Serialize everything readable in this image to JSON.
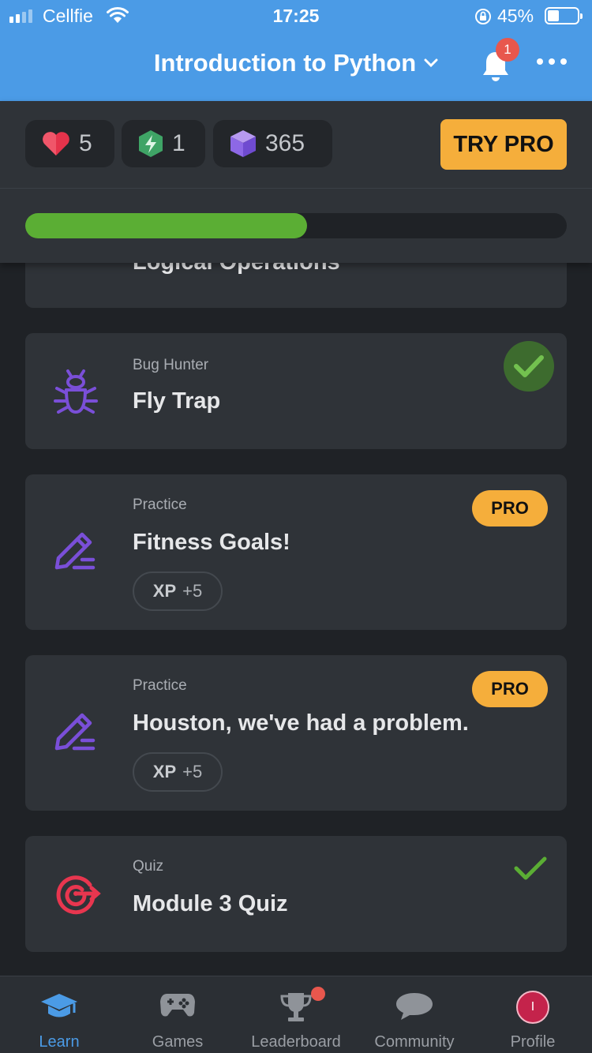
{
  "status_bar": {
    "carrier": "Cellfie",
    "time": "17:25",
    "battery_percent": "45%",
    "battery_level": 0.45
  },
  "header": {
    "title": "Introduction to Python",
    "notification_count": "1"
  },
  "stats": {
    "hearts": "5",
    "energy": "1",
    "gems": "365",
    "try_pro_label": "TRY PRO",
    "course_progress": 0.52
  },
  "cards": [
    {
      "type": "",
      "name": "Logical Operations",
      "icon": "partial"
    },
    {
      "type": "Bug Hunter",
      "name": "Fly Trap",
      "icon": "bug-icon",
      "status": "completed"
    },
    {
      "type": "Practice",
      "name": "Fitness Goals!",
      "icon": "pencil-icon",
      "pro_label": "PRO",
      "xp_label": "XP",
      "xp_value": "+5"
    },
    {
      "type": "Practice",
      "name": "Houston, we've had a problem.",
      "icon": "pencil-icon",
      "pro_label": "PRO",
      "xp_label": "XP",
      "xp_value": "+5"
    },
    {
      "type": "Quiz",
      "name": "Module 3 Quiz",
      "icon": "target-icon",
      "status": "completed"
    }
  ],
  "tabs": [
    {
      "label": "Learn",
      "icon": "graduation-cap-icon",
      "active": true
    },
    {
      "label": "Games",
      "icon": "gamepad-icon"
    },
    {
      "label": "Leaderboard",
      "icon": "trophy-icon"
    },
    {
      "label": "Community",
      "icon": "chat-bubble-icon"
    },
    {
      "label": "Profile",
      "icon": "avatar",
      "avatar_initial": "I"
    }
  ],
  "colors": {
    "header": "#4b9be6",
    "background": "#1f2226",
    "card": "#2f3338",
    "accent_pro": "#f5ae3b",
    "progress": "#5bae34",
    "icon_purple": "#7a4fd8",
    "icon_red": "#e8364f"
  }
}
